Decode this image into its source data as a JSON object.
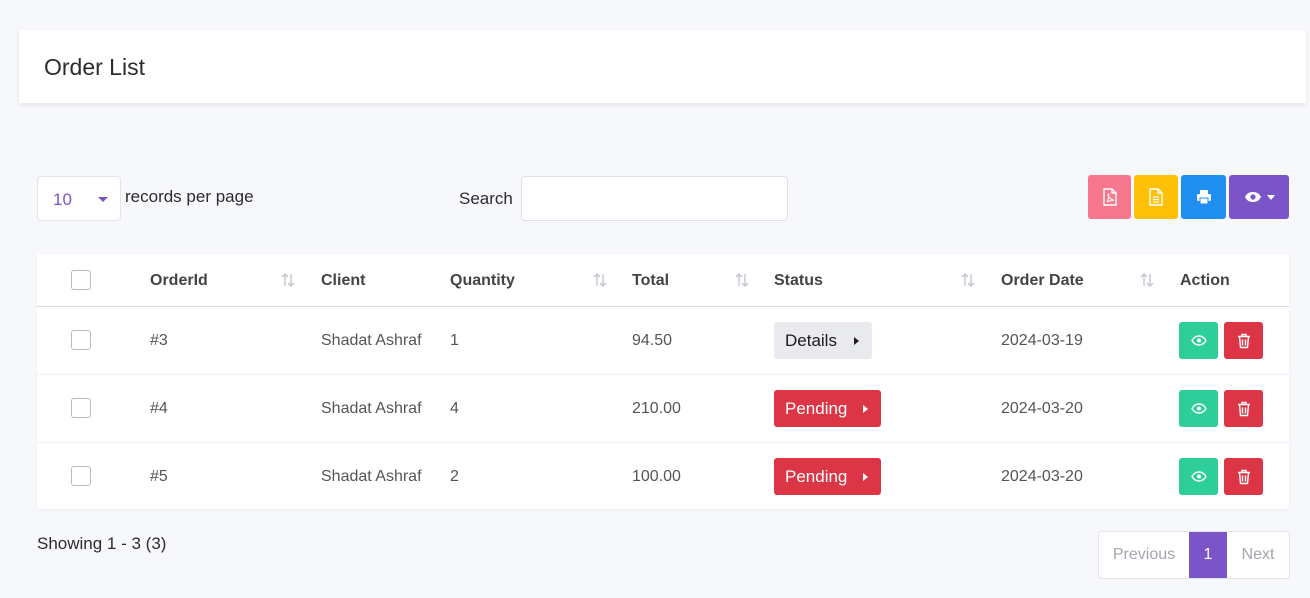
{
  "page": {
    "title": "Order List"
  },
  "toolbar": {
    "per_page_value": "10",
    "per_page_label": "records per page",
    "search_label": "Search",
    "search_value": "",
    "buttons": [
      {
        "name": "export-pdf",
        "icon": "file-pdf-icon",
        "color": "#f6778e"
      },
      {
        "name": "export-csv",
        "icon": "file-text-icon",
        "color": "#ffc107"
      },
      {
        "name": "print",
        "icon": "printer-icon",
        "color": "#1f8ef1"
      },
      {
        "name": "column-visibility",
        "icon": "eye-icon",
        "color": "#7b55c7"
      }
    ]
  },
  "table": {
    "columns": [
      "OrderId",
      "Client",
      "Quantity",
      "Total",
      "Status",
      "Order Date",
      "Action"
    ],
    "rows": [
      {
        "order_id": "#3",
        "client": "Shadat Ashraf",
        "quantity": "1",
        "total": "94.50",
        "status": "Details",
        "order_date": "2024-03-19"
      },
      {
        "order_id": "#4",
        "client": "Shadat Ashraf",
        "quantity": "4",
        "total": "210.00",
        "status": "Pending",
        "order_date": "2024-03-20"
      },
      {
        "order_id": "#5",
        "client": "Shadat Ashraf",
        "quantity": "2",
        "total": "100.00",
        "status": "Pending",
        "order_date": "2024-03-20"
      }
    ]
  },
  "footer": {
    "showing": "Showing 1 - 3 (3)",
    "pagination": {
      "previous": "Previous",
      "current": "1",
      "next": "Next"
    }
  },
  "colors": {
    "accent": "#7b55c7",
    "success": "#2dce9a",
    "danger": "#dc3545"
  }
}
